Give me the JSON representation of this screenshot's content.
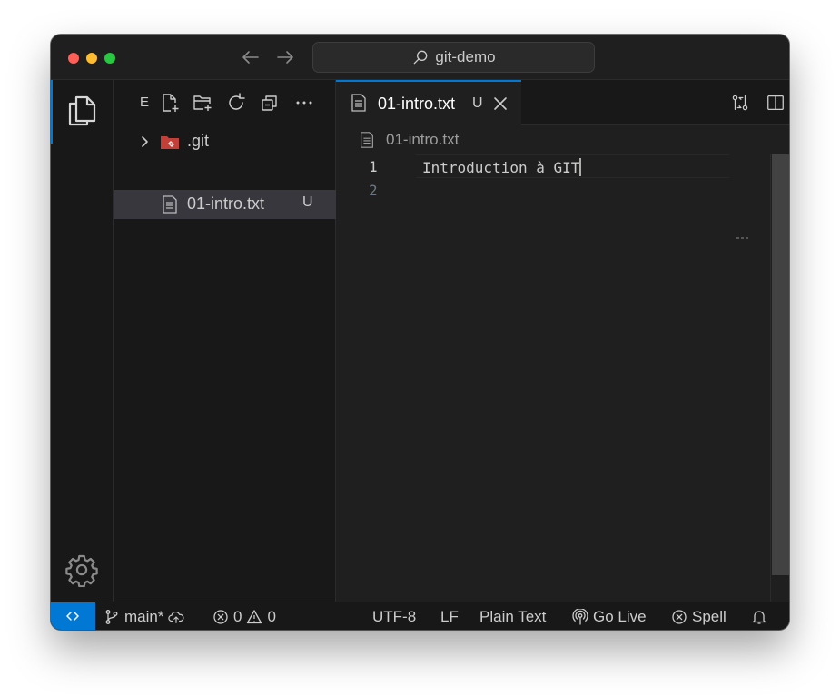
{
  "window": {
    "search_label": "git-demo"
  },
  "sidebar": {
    "title": "E",
    "tree": [
      {
        "name": ".git",
        "type": "folder",
        "badge": ""
      },
      {
        "name": "01-intro.txt",
        "type": "file",
        "badge": "U"
      }
    ]
  },
  "editor": {
    "tab": {
      "label": "01-intro.txt",
      "badge": "U"
    },
    "breadcrumb": "01-intro.txt",
    "lines": [
      {
        "number": "1",
        "text": "Introduction à GIT"
      },
      {
        "number": "2",
        "text": ""
      }
    ]
  },
  "statusbar": {
    "branch": "main*",
    "errors": "0",
    "warnings": "0",
    "encoding": "UTF-8",
    "eol": "LF",
    "language": "Plain Text",
    "golive": "Go Live",
    "spell": "Spell"
  },
  "colors": {
    "accent": "#0078d4",
    "background": "#1f1f1f",
    "sidebar": "#181818",
    "git_folder": "#c24038"
  }
}
